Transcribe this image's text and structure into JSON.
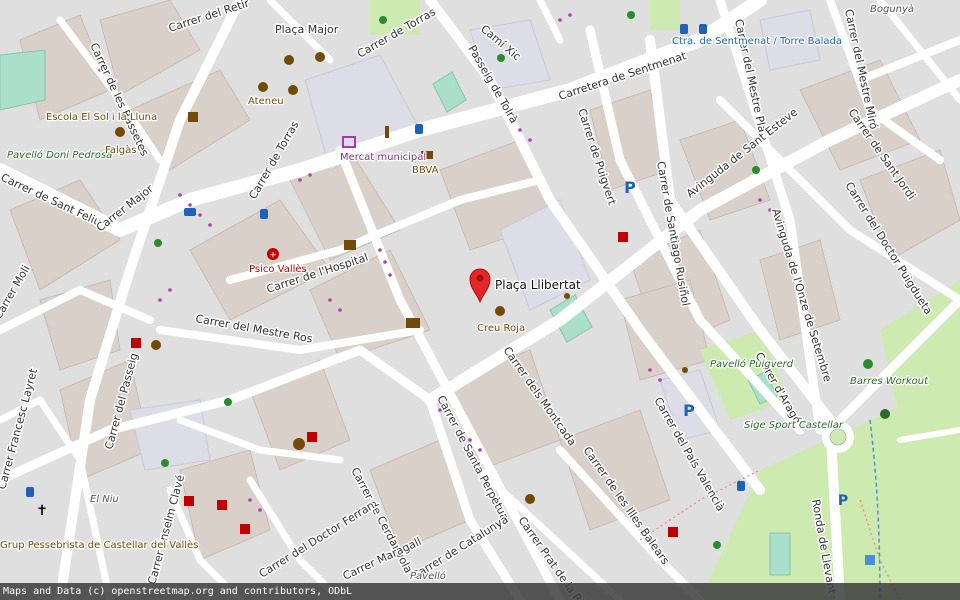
{
  "map": {
    "marker_label": "Plaça Llibertat",
    "attribution": "Maps and Data (c) openstreetmap.org and contributors, ODbL",
    "colors": {
      "background": "#e0dfdf",
      "building": "#d9d0c9",
      "road": "#ffffff",
      "park": "#cdebb0",
      "pitch": "#aae0cb",
      "pedestrian": "#dddde8",
      "marker": "#e32727",
      "brown_poi": "#734a08",
      "green_poi": "#2c6b2c",
      "red_poi": "#c20000",
      "blue_poi": "#1d62b7"
    },
    "streets": [
      "Carrer del Retir",
      "Plaça Major",
      "Carrer de Torras",
      "Camí Xic",
      "Carretera de Sentmenat",
      "Carrer del Mestre Miró",
      "Carrer de les Bassetes",
      "Passeig de Tolrà",
      "Carrer del Mestre Pla",
      "Carrer de Torras",
      "Carrer de Puigvert",
      "Carrer de Santiago Rusiñol",
      "Avinguda de Sant Esteve",
      "Carrer de Sant Jordi",
      "Carrer del Doctor Puigdueta",
      "Carrer de Sant Feliu",
      "Carrer Major",
      "Carrer de l'Hospital",
      "Avinguda de l'Onze de Setembre",
      "Carrer del Mestre Ros",
      "Carrer dels Montcada",
      "Carrer d'Aragó",
      "Carrer del Passeig",
      "Carrer del País Valencià",
      "Carrer de Santa Perpètua",
      "Carrer de les Illes Balears",
      "Carrer de Cerdanyola",
      "Carrer del Doctor Ferran",
      "Carrer Anselm Clavé",
      "Carrer de Catalunya",
      "Carrer Prat de la Riba",
      "Ronda de Llevant",
      "Carrer Maragall",
      "Carrer Moli",
      "Carrer Francesc Layret"
    ],
    "pois": [
      {
        "name": "Ateneu",
        "type": "brown"
      },
      {
        "name": "Mercat municipal",
        "type": "purple"
      },
      {
        "name": "BBVA",
        "type": "brown"
      },
      {
        "name": "Ctra. de Sentmenat / Torre Balada",
        "type": "blue"
      },
      {
        "name": "Escola El Sol i la Lluna",
        "type": "brown"
      },
      {
        "name": "Pavelló Doni Pedrosa",
        "type": "green"
      },
      {
        "name": "Falgàs",
        "type": "brown"
      },
      {
        "name": "Bogunyà",
        "type": "dark"
      },
      {
        "name": "Psico Vallès",
        "type": "red"
      },
      {
        "name": "Creu Roja",
        "type": "brown"
      },
      {
        "name": "Pavelló Puigverd",
        "type": "green"
      },
      {
        "name": "Barres Workout",
        "type": "green"
      },
      {
        "name": "Sige Sport Castellar",
        "type": "green"
      },
      {
        "name": "El Niu",
        "type": "dark"
      },
      {
        "name": "Grup Pessebrista de Castellar del Vallès",
        "type": "brown"
      },
      {
        "name": "Pavelló",
        "type": "dark"
      }
    ]
  }
}
